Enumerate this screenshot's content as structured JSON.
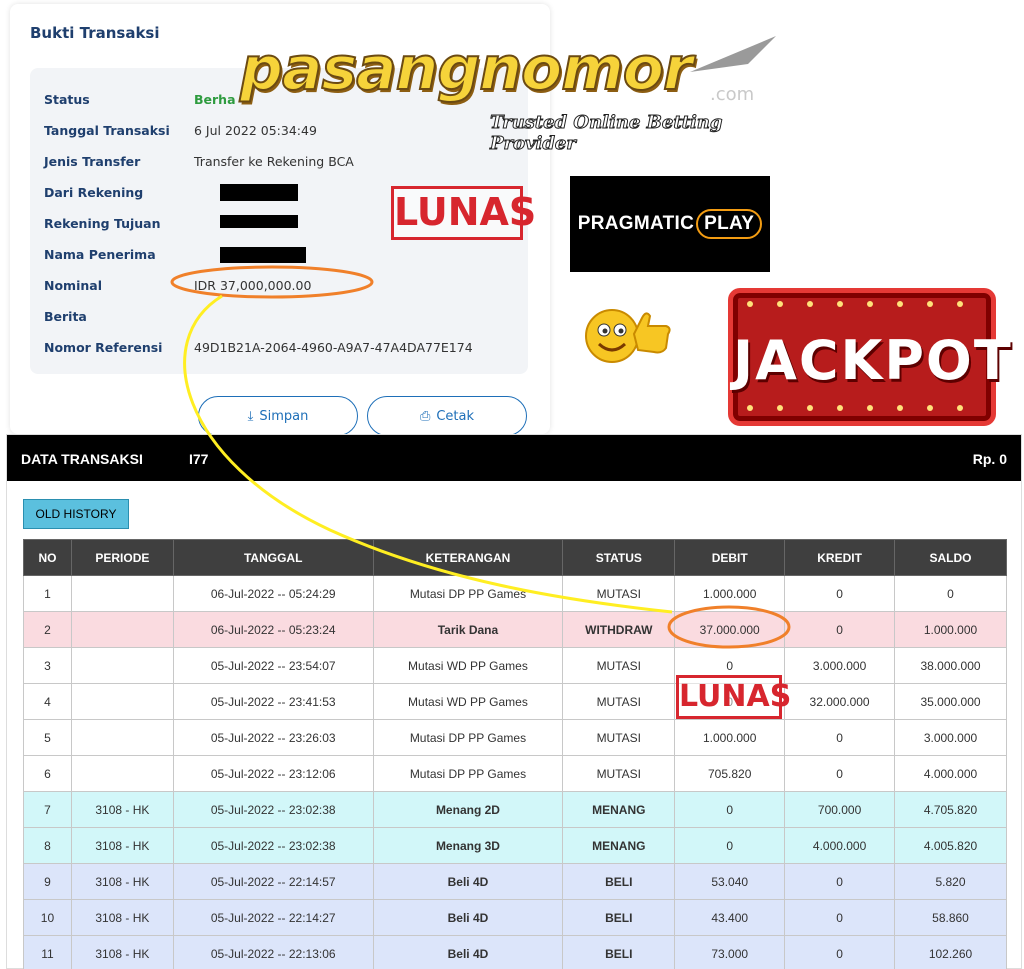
{
  "receipt": {
    "title": "Bukti Transaksi",
    "fields": [
      {
        "label": "Status",
        "value": "Berha"
      },
      {
        "label": "Tanggal Transaksi",
        "value": "6 Jul 2022 05:34:49"
      },
      {
        "label": "Jenis Transfer",
        "value": "Transfer ke Rekening BCA"
      },
      {
        "label": "Dari Rekening",
        "value": ""
      },
      {
        "label": "Rekening Tujuan",
        "value": ""
      },
      {
        "label": "Nama Penerima",
        "value": ""
      },
      {
        "label": "Nominal",
        "value": "IDR 37,000,000.00"
      },
      {
        "label": "Berita",
        "value": ""
      },
      {
        "label": "Nomor Referensi",
        "value": "49D1B21A-2064-4960-A9A7-47A4DA77E174"
      }
    ],
    "save_label": "Simpan",
    "print_label": "Cetak",
    "save_icon": "download-icon",
    "print_icon": "printer-icon"
  },
  "branding": {
    "logo_text": "pasangnomor",
    "logo_suffix": ".com",
    "tagline": "Trusted Online Betting Provider",
    "stamp_text": "LUNAS",
    "provider_text": "PRAGMATIC",
    "provider_play": "PLAY",
    "jackpot_text": "JACKPOT",
    "colors": {
      "logo_gold": "#f6d33a",
      "stamp_red": "#d7262e",
      "highlight_orange": "#f0802a",
      "connector_yellow": "#ffee22",
      "jackpot_red": "#b71c1c"
    }
  },
  "transactions": {
    "title": "DATA TRANSAKSI",
    "user_suffix": "I77",
    "balance": "Rp. 0",
    "old_history_label": "OLD HISTORY",
    "columns": [
      "NO",
      "PERIODE",
      "TANGGAL",
      "KETERANGAN",
      "STATUS",
      "DEBIT",
      "KREDIT",
      "SALDO"
    ],
    "rows": [
      {
        "no": "1",
        "periode": "",
        "tanggal": "06-Jul-2022 -- 05:24:29",
        "keterangan": "Mutasi DP PP Games",
        "status": "MUTASI",
        "debit": "1.000.000",
        "kredit": "0",
        "saldo": "0",
        "kind": "default"
      },
      {
        "no": "2",
        "periode": "",
        "tanggal": "06-Jul-2022 -- 05:23:24",
        "keterangan": "Tarik Dana",
        "status": "WITHDRAW",
        "debit": "37.000.000",
        "kredit": "0",
        "saldo": "1.000.000",
        "kind": "withdraw"
      },
      {
        "no": "3",
        "periode": "",
        "tanggal": "05-Jul-2022 -- 23:54:07",
        "keterangan": "Mutasi WD PP Games",
        "status": "MUTASI",
        "debit": "0",
        "kredit": "3.000.000",
        "saldo": "38.000.000",
        "kind": "default"
      },
      {
        "no": "4",
        "periode": "",
        "tanggal": "05-Jul-2022 -- 23:41:53",
        "keterangan": "Mutasi WD PP Games",
        "status": "MUTASI",
        "debit": "0",
        "kredit": "32.000.000",
        "saldo": "35.000.000",
        "kind": "default"
      },
      {
        "no": "5",
        "periode": "",
        "tanggal": "05-Jul-2022 -- 23:26:03",
        "keterangan": "Mutasi DP PP Games",
        "status": "MUTASI",
        "debit": "1.000.000",
        "kredit": "0",
        "saldo": "3.000.000",
        "kind": "default"
      },
      {
        "no": "6",
        "periode": "",
        "tanggal": "05-Jul-2022 -- 23:12:06",
        "keterangan": "Mutasi DP PP Games",
        "status": "MUTASI",
        "debit": "705.820",
        "kredit": "0",
        "saldo": "4.000.000",
        "kind": "default"
      },
      {
        "no": "7",
        "periode": "3108 - HK",
        "tanggal": "05-Jul-2022 -- 23:02:38",
        "keterangan": "Menang 2D",
        "status": "MENANG",
        "debit": "0",
        "kredit": "700.000",
        "saldo": "4.705.820",
        "kind": "win"
      },
      {
        "no": "8",
        "periode": "3108 - HK",
        "tanggal": "05-Jul-2022 -- 23:02:38",
        "keterangan": "Menang 3D",
        "status": "MENANG",
        "debit": "0",
        "kredit": "4.000.000",
        "saldo": "4.005.820",
        "kind": "win"
      },
      {
        "no": "9",
        "periode": "3108 - HK",
        "tanggal": "05-Jul-2022 -- 22:14:57",
        "keterangan": "Beli 4D",
        "status": "BELI",
        "debit": "53.040",
        "kredit": "0",
        "saldo": "5.820",
        "kind": "buy"
      },
      {
        "no": "10",
        "periode": "3108 - HK",
        "tanggal": "05-Jul-2022 -- 22:14:27",
        "keterangan": "Beli 4D",
        "status": "BELI",
        "debit": "43.400",
        "kredit": "0",
        "saldo": "58.860",
        "kind": "buy"
      },
      {
        "no": "11",
        "periode": "3108 - HK",
        "tanggal": "05-Jul-2022 -- 22:13:06",
        "keterangan": "Beli 4D",
        "status": "BELI",
        "debit": "73.000",
        "kredit": "0",
        "saldo": "102.260",
        "kind": "buy"
      }
    ]
  }
}
